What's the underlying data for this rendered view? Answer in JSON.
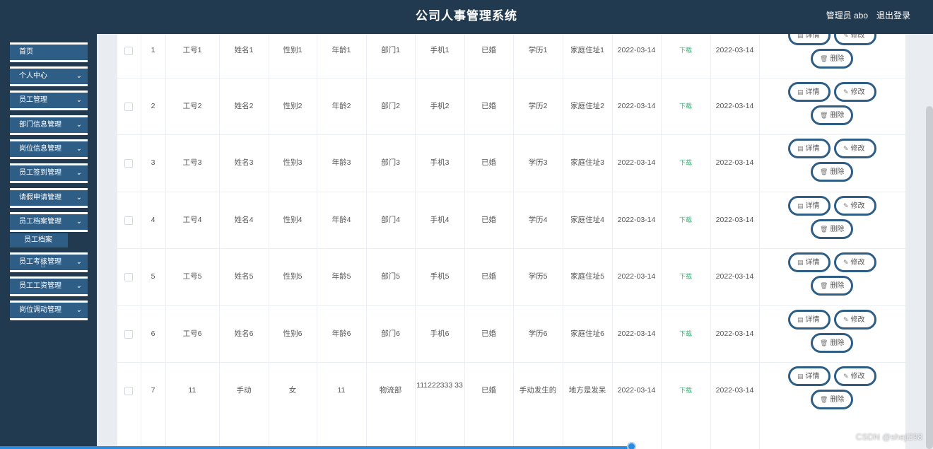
{
  "header": {
    "title": "公司人事管理系统",
    "admin_label": "管理员 abo",
    "logout_label": "退出登录"
  },
  "sidebar": {
    "items": [
      {
        "label": "首页",
        "has_chevron": false
      },
      {
        "label": "个人中心",
        "has_chevron": true
      },
      {
        "label": "员工管理",
        "has_chevron": true
      },
      {
        "label": "部门信息管理",
        "has_chevron": true
      },
      {
        "label": "岗位信息管理",
        "has_chevron": true
      },
      {
        "label": "员工签到管理",
        "has_chevron": true
      },
      {
        "label": "请假申请管理",
        "has_chevron": true
      },
      {
        "label": "员工档案管理",
        "has_chevron": true
      },
      {
        "label": "员工考核管理",
        "has_chevron": true
      },
      {
        "label": "员工工资管理",
        "has_chevron": true
      },
      {
        "label": "岗位调动管理",
        "has_chevron": true
      }
    ],
    "submenu": {
      "label": "员工档案"
    }
  },
  "actions": {
    "detail_label": "详情",
    "edit_label": "修改",
    "delete_label": "删除"
  },
  "table": {
    "rows": [
      {
        "index": "1",
        "emp_no": "工号1",
        "name": "姓名1",
        "gender": "性别1",
        "age": "年龄1",
        "dept": "部门1",
        "phone": "手机1",
        "marital": "已婚",
        "education": "学历1",
        "address": "家庭住址1",
        "date1": "2022-03-14",
        "download": "下载",
        "date2": "2022-03-14"
      },
      {
        "index": "2",
        "emp_no": "工号2",
        "name": "姓名2",
        "gender": "性别2",
        "age": "年龄2",
        "dept": "部门2",
        "phone": "手机2",
        "marital": "已婚",
        "education": "学历2",
        "address": "家庭住址2",
        "date1": "2022-03-14",
        "download": "下载",
        "date2": "2022-03-14"
      },
      {
        "index": "3",
        "emp_no": "工号3",
        "name": "姓名3",
        "gender": "性别3",
        "age": "年龄3",
        "dept": "部门3",
        "phone": "手机3",
        "marital": "已婚",
        "education": "学历3",
        "address": "家庭住址3",
        "date1": "2022-03-14",
        "download": "下载",
        "date2": "2022-03-14"
      },
      {
        "index": "4",
        "emp_no": "工号4",
        "name": "姓名4",
        "gender": "性别4",
        "age": "年龄4",
        "dept": "部门4",
        "phone": "手机4",
        "marital": "已婚",
        "education": "学历4",
        "address": "家庭住址4",
        "date1": "2022-03-14",
        "download": "下载",
        "date2": "2022-03-14"
      },
      {
        "index": "5",
        "emp_no": "工号5",
        "name": "姓名5",
        "gender": "性别5",
        "age": "年龄5",
        "dept": "部门5",
        "phone": "手机5",
        "marital": "已婚",
        "education": "学历5",
        "address": "家庭住址5",
        "date1": "2022-03-14",
        "download": "下载",
        "date2": "2022-03-14"
      },
      {
        "index": "6",
        "emp_no": "工号6",
        "name": "姓名6",
        "gender": "性别6",
        "age": "年龄6",
        "dept": "部门6",
        "phone": "手机6",
        "marital": "已婚",
        "education": "学历6",
        "address": "家庭住址6",
        "date1": "2022-03-14",
        "download": "下载",
        "date2": "2022-03-14"
      },
      {
        "index": "7",
        "emp_no": "11",
        "name": "手动",
        "gender": "女",
        "age": "11",
        "dept": "物流部",
        "phone": "111222333 33",
        "marital": "已婚",
        "education": "手动发生的",
        "address": "地方是发呆",
        "date1": "2022-03-14",
        "download": "下载",
        "date2": "2022-03-14"
      }
    ]
  },
  "watermark": "CSDN @sheji298",
  "colors": {
    "header_bg": "#213a50",
    "menu_bg": "#2e5d86",
    "download_link": "#2bb673",
    "progress": "#2a8be0"
  }
}
